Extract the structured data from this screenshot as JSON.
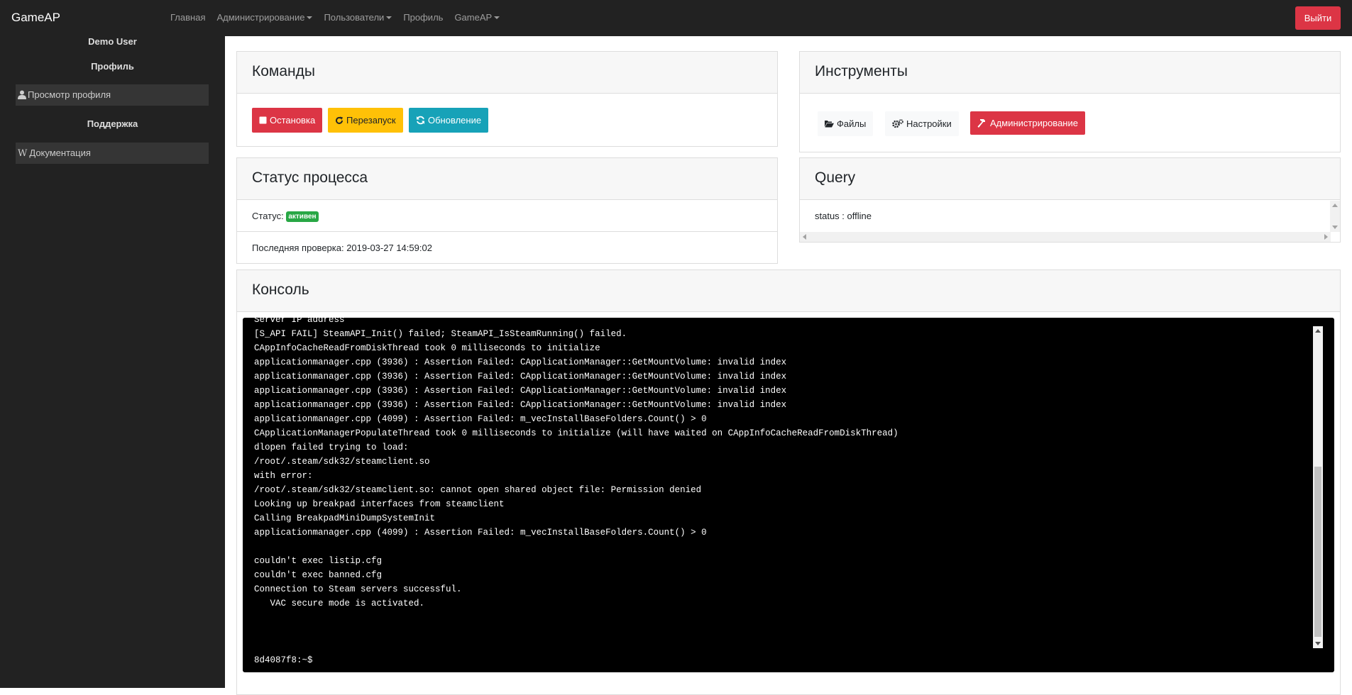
{
  "navbar": {
    "brand": "GameAP",
    "links": [
      {
        "label": "Главная",
        "dropdown": false
      },
      {
        "label": "Администрирование",
        "dropdown": true
      },
      {
        "label": "Пользователи",
        "dropdown": true
      },
      {
        "label": "Профиль",
        "dropdown": false
      },
      {
        "label": "GameAP",
        "dropdown": true
      }
    ],
    "logout_label": "Выйти",
    "logout_color": "#dc3545"
  },
  "sidebar": {
    "user_name": "Demo User",
    "profile_heading": "Профиль",
    "profile_item": {
      "label": "Просмотр профиля",
      "icon": "user-icon"
    },
    "support_heading": "Поддержка",
    "docs_item": {
      "label": "Документация",
      "icon": "wikipedia-w-icon"
    }
  },
  "commands": {
    "title": "Команды",
    "stop_label": "Остановка",
    "restart_label": "Перезапуск",
    "update_label": "Обновление"
  },
  "tools": {
    "title": "Инструменты",
    "files_label": "Файлы",
    "settings_label": "Настройки",
    "admin_label": "Администрирование"
  },
  "status": {
    "title": "Статус процесса",
    "status_label": "Статус:",
    "status_badge": "активен",
    "badge_color": "#28a745",
    "last_check": "Последняя проверка: 2019-03-27 14:59:02"
  },
  "query": {
    "title": "Query",
    "text": "status : offline"
  },
  "console": {
    "title": "Консоль",
    "lines": [
      "Server IP address",
      "[S_API FAIL] SteamAPI_Init() failed; SteamAPI_IsSteamRunning() failed.",
      "CAppInfoCacheReadFromDiskThread took 0 milliseconds to initialize",
      "applicationmanager.cpp (3936) : Assertion Failed: CApplicationManager::GetMountVolume: invalid index",
      "applicationmanager.cpp (3936) : Assertion Failed: CApplicationManager::GetMountVolume: invalid index",
      "applicationmanager.cpp (3936) : Assertion Failed: CApplicationManager::GetMountVolume: invalid index",
      "applicationmanager.cpp (3936) : Assertion Failed: CApplicationManager::GetMountVolume: invalid index",
      "applicationmanager.cpp (4099) : Assertion Failed: m_vecInstallBaseFolders.Count() > 0",
      "CApplicationManagerPopulateThread took 0 milliseconds to initialize (will have waited on CAppInfoCacheReadFromDiskThread)",
      "dlopen failed trying to load:",
      "/root/.steam/sdk32/steamclient.so",
      "with error:",
      "/root/.steam/sdk32/steamclient.so: cannot open shared object file: Permission denied",
      "Looking up breakpad interfaces from steamclient",
      "Calling BreakpadMiniDumpSystemInit",
      "applicationmanager.cpp (4099) : Assertion Failed: m_vecInstallBaseFolders.Count() > 0",
      "",
      "couldn't exec listip.cfg",
      "couldn't exec banned.cfg",
      "Connection to Steam servers successful.",
      "   VAC secure mode is activated."
    ],
    "prompt": "8d4087f8:~$"
  }
}
